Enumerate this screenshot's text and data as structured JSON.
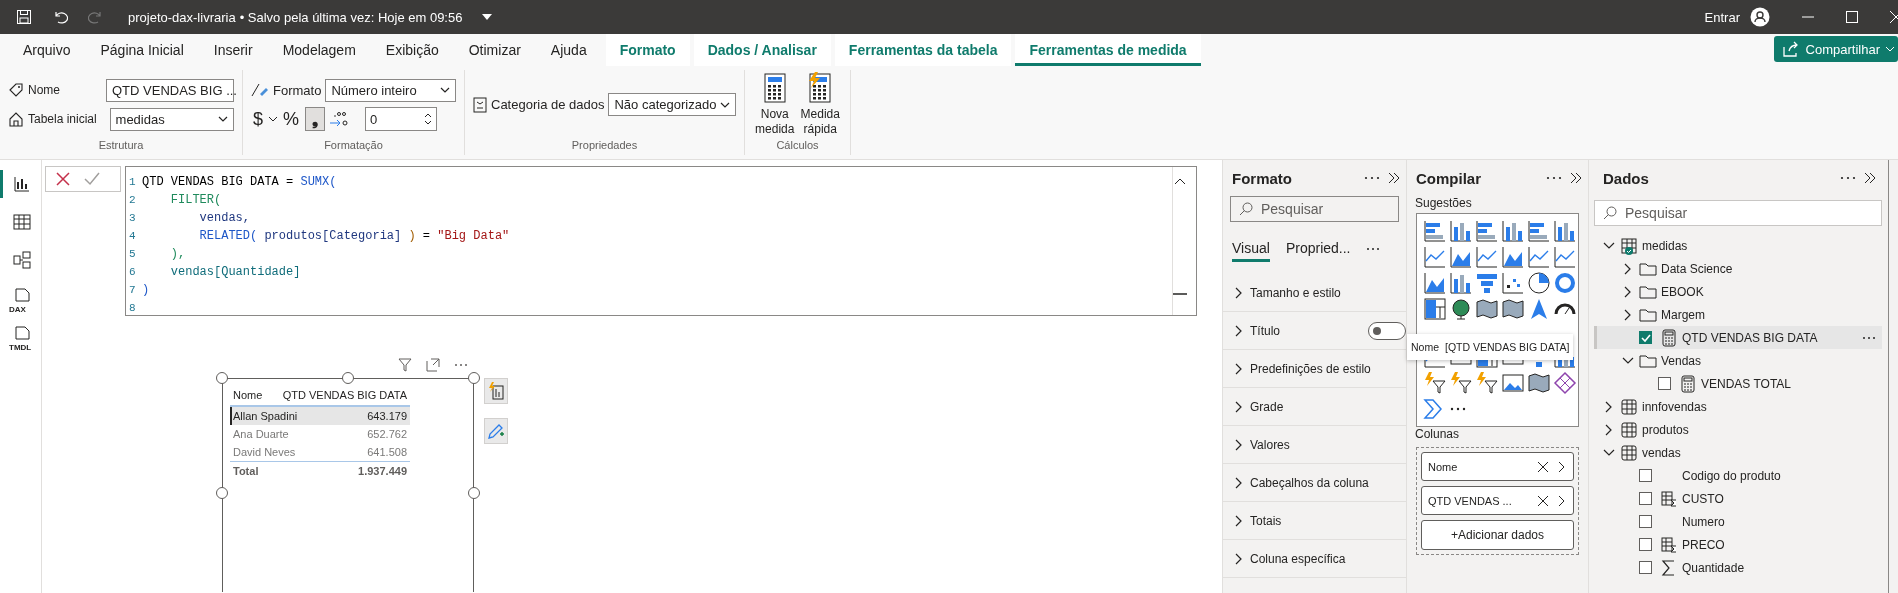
{
  "title_bar": {
    "document": "projeto-dax-livraria",
    "save_status": "• Salvo pela última vez: Hoje em 09:56",
    "sign_in": "Entrar"
  },
  "ribbon_tabs": [
    {
      "label": "Arquivo",
      "kind": "main",
      "selected": false
    },
    {
      "label": "Página Inicial",
      "kind": "main",
      "selected": false
    },
    {
      "label": "Inserir",
      "kind": "main",
      "selected": false
    },
    {
      "label": "Modelagem",
      "kind": "main",
      "selected": false
    },
    {
      "label": "Exibição",
      "kind": "main",
      "selected": false
    },
    {
      "label": "Otimizar",
      "kind": "main",
      "selected": false
    },
    {
      "label": "Ajuda",
      "kind": "main",
      "selected": false
    },
    {
      "label": "Formato",
      "kind": "context",
      "selected": false
    },
    {
      "label": "Dados / Analisar",
      "kind": "context",
      "selected": false
    },
    {
      "label": "Ferramentas da tabela",
      "kind": "context",
      "selected": false
    },
    {
      "label": "Ferramentas de medida",
      "kind": "context",
      "selected": true
    }
  ],
  "share_button": "Compartilhar",
  "ribbon": {
    "estrutura": {
      "name_label": "Nome",
      "name_value": "QTD VENDAS BIG ...",
      "home_table_label": "Tabela inicial",
      "home_table_value": "medidas",
      "group_label": "Estrutura"
    },
    "formatacao": {
      "format_label": "Formato",
      "format_value": "Número inteiro",
      "currency": "$",
      "percent": "%",
      "separator": {
        "label": "❟",
        "selected": true
      },
      "decimal_places": "0",
      "group_label": "Formatação"
    },
    "propriedades": {
      "category_label": "Categoria de dados",
      "category_value": "Não categorizado",
      "group_label": "Propriedades"
    },
    "calculos": {
      "buttons": [
        {
          "label": "Nova medida",
          "kind": "new"
        },
        {
          "label": "Medida rápida",
          "kind": "quick"
        }
      ],
      "group_label": "Cálculos"
    }
  },
  "rail": [
    {
      "kind": "report",
      "selected": true
    },
    {
      "kind": "table",
      "selected": false
    },
    {
      "kind": "model",
      "selected": false
    },
    {
      "kind": "dax",
      "badge": "DAX",
      "selected": false
    },
    {
      "kind": "tmdl",
      "badge": "TMDL",
      "selected": false
    }
  ],
  "formula": {
    "lines": [
      {
        "number": "1",
        "tokens": [
          {
            "text": "QTD VENDAS BIG DATA = ",
            "kind": "text"
          },
          {
            "text": "SUMX(",
            "kind": "function"
          }
        ]
      },
      {
        "number": "2",
        "tokens": [
          {
            "text": "    FILTER(",
            "kind": "level2"
          }
        ]
      },
      {
        "number": "3",
        "tokens": [
          {
            "text": "        vendas,",
            "kind": "table"
          }
        ]
      },
      {
        "number": "4",
        "tokens": [
          {
            "text": "        RELATED( ",
            "kind": "function"
          },
          {
            "text": "produtos[Categoria]",
            "kind": "table"
          },
          {
            "text": " ) ",
            "kind": "level3"
          },
          {
            "text": "= ",
            "kind": "text"
          },
          {
            "text": "\"Big Data\"",
            "kind": "string"
          }
        ]
      },
      {
        "number": "5",
        "tokens": [
          {
            "text": "    ),",
            "kind": "level2"
          }
        ]
      },
      {
        "number": "6",
        "tokens": [
          {
            "text": "    vendas[Quantidade]",
            "kind": "column"
          }
        ]
      },
      {
        "number": "7",
        "tokens": [
          {
            "text": ")",
            "kind": "function"
          }
        ]
      },
      {
        "number": "8"
      }
    ]
  },
  "visual": {
    "columns": [
      "Nome",
      "QTD VENDAS BIG DATA"
    ],
    "rows": [
      {
        "name": "Allan Spadini",
        "value": "643.179",
        "selected": true
      },
      {
        "name": "Ana Duarte",
        "value": "652.762",
        "selected": false
      },
      {
        "name": "David Neves",
        "value": "641.508",
        "selected": false
      }
    ],
    "total": {
      "label": "Total",
      "value": "1.937.449"
    }
  },
  "format_pane": {
    "title": "Formato",
    "search_placeholder": "Pesquisar",
    "tabs": [
      {
        "label": "Visual",
        "selected": true
      },
      {
        "label": "Propried...",
        "selected": false
      }
    ],
    "sections": [
      {
        "label": "Tamanho e estilo",
        "kind": "plain"
      },
      {
        "label": "Título",
        "kind": "toggle",
        "on": false
      },
      {
        "label": "Predefinições de estilo",
        "kind": "plain"
      },
      {
        "label": "Grade",
        "kind": "plain"
      },
      {
        "label": "Valores",
        "kind": "plain"
      },
      {
        "label": "Cabeçalhos da coluna",
        "kind": "plain"
      },
      {
        "label": "Totais",
        "kind": "plain"
      },
      {
        "label": "Coluna específica",
        "kind": "plain"
      }
    ]
  },
  "build_pane": {
    "title": "Compilar",
    "suggestions_label": "Sugestões",
    "columns_label": "Colunas",
    "wells": [
      {
        "label": "Nome"
      },
      {
        "label": "QTD VENDAS ..."
      }
    ],
    "add_button": "+Adicionar dados"
  },
  "tooltip": {
    "label": "Nome",
    "value": "[QTD VENDAS BIG DATA]"
  },
  "data_pane": {
    "title": "Dados",
    "search_placeholder": "Pesquisar",
    "tree": [
      {
        "label": "medidas",
        "kind": "measure_table",
        "expanded": true,
        "selected": false,
        "children": [
          {
            "label": "Data Science",
            "kind": "folder",
            "expanded": false,
            "selected": false
          },
          {
            "label": "EBOOK",
            "kind": "folder",
            "expanded": false,
            "selected": false
          },
          {
            "label": "Margem",
            "kind": "folder",
            "expanded": false,
            "selected": false
          },
          {
            "label": "QTD VENDAS BIG DATA",
            "kind": "measure",
            "checked": true,
            "selected": true
          },
          {
            "label": "Vendas",
            "kind": "folder",
            "expanded": true,
            "selected": false,
            "children": [
              {
                "label": "VENDAS TOTAL",
                "kind": "measure",
                "checked": false,
                "selected": false
              }
            ]
          }
        ]
      },
      {
        "label": "innfovendas",
        "kind": "table",
        "expanded": false,
        "selected": false
      },
      {
        "label": "produtos",
        "kind": "table",
        "expanded": false,
        "selected": false
      },
      {
        "label": "vendas",
        "kind": "table",
        "expanded": true,
        "selected": false,
        "children": [
          {
            "label": "Codigo do produto",
            "kind": "field",
            "checked": false,
            "selected": false
          },
          {
            "label": "CUSTO",
            "kind": "calc_field",
            "checked": false,
            "selected": false
          },
          {
            "label": "Numero",
            "kind": "field",
            "checked": false,
            "selected": false
          },
          {
            "label": "PRECO",
            "kind": "calc_field",
            "checked": false,
            "selected": false
          },
          {
            "label": "Quantidade",
            "kind": "sum_field",
            "checked": false,
            "selected": false
          }
        ]
      }
    ]
  }
}
